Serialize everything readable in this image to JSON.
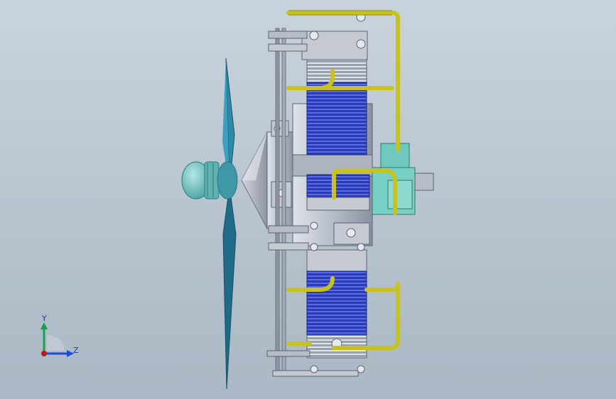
{
  "scene": {
    "subject": "radial-engine-assembly",
    "background_top": "#c9d3dc",
    "background_bottom": "#aab8c5"
  },
  "colors": {
    "propeller": "#2f8aa8",
    "propeller_dark": "#1f6a86",
    "spinner": "#6fc2c0",
    "cone": "#a7adb8",
    "steel": "#b6bcc8",
    "steel_dark": "#7d8594",
    "cylinder_blue": "#2b3bb8",
    "pipe": "#c8c21e",
    "pipe_dark": "#8f8a10",
    "accessory": "#6fc7bd"
  },
  "triad": {
    "y_label": "Y",
    "z_label": "Z",
    "y_color": "#16a34a",
    "z_color": "#1d4ed8",
    "origin_color": "#b91c1c"
  }
}
